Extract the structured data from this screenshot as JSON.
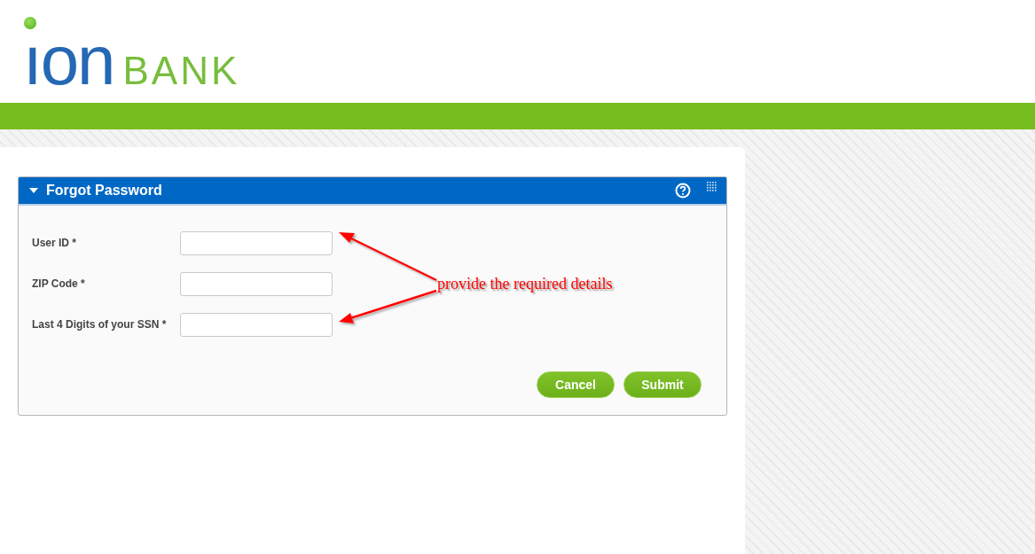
{
  "logo": {
    "word": "ıon",
    "bank": "BANK"
  },
  "panel": {
    "title": "Forgot Password",
    "expanded": true
  },
  "fields": [
    {
      "label": "User ID *"
    },
    {
      "label": "ZIP Code *"
    },
    {
      "label": "Last 4 Digits of your SSN *"
    }
  ],
  "buttons": [
    "Cancel",
    "Submit"
  ],
  "annotation": {
    "text": "provide the required details"
  }
}
